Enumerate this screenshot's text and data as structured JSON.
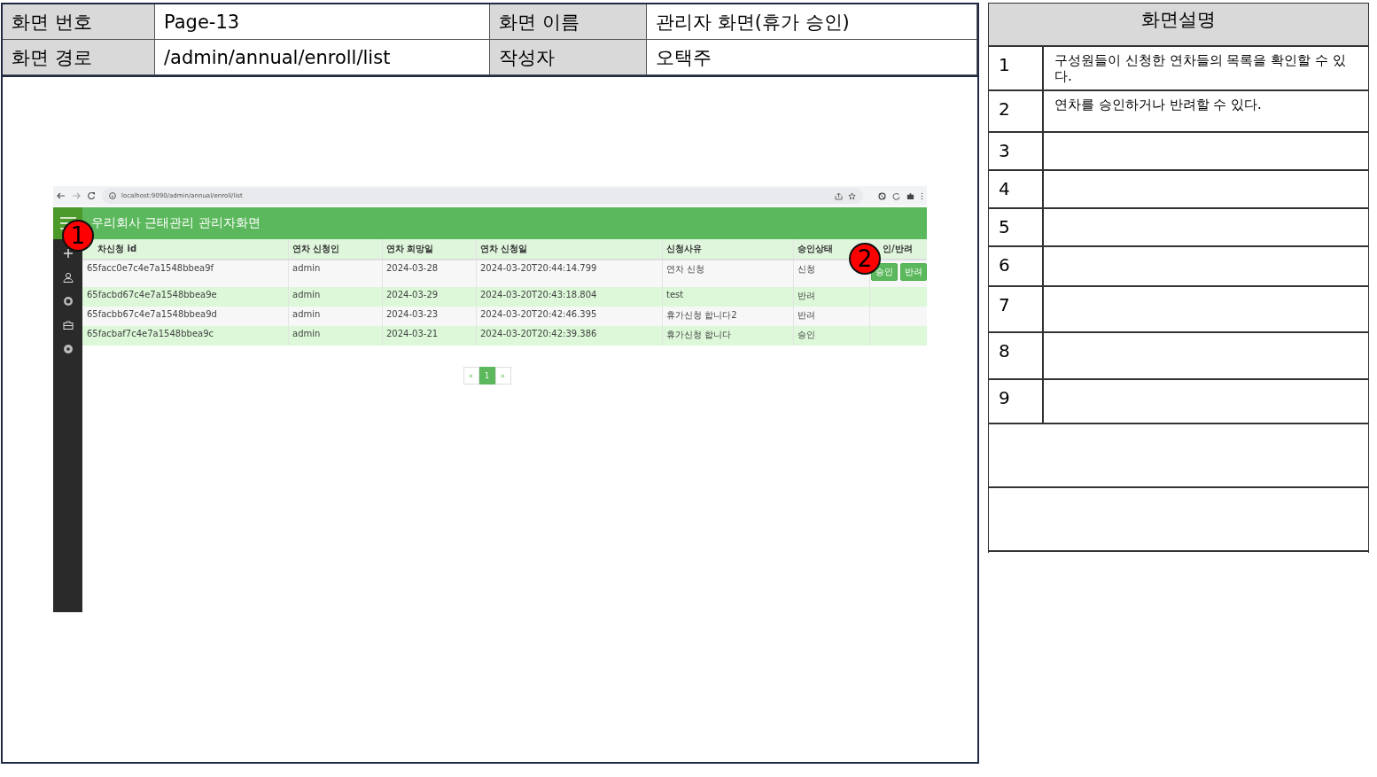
{
  "header": {
    "screen_no_label": "화면 번호",
    "screen_no": "Page-13",
    "screen_name_label": "화면 이름",
    "screen_name": "관리자 화면(휴가 승인)",
    "path_label": "화면 경로",
    "path": "/admin/annual/enroll/list",
    "author_label": "작성자",
    "author": "오택주"
  },
  "browser": {
    "url": "localhost:9090/admin/annual/enroll/list"
  },
  "app": {
    "title": "우리회사 근태관리 관리자화면",
    "columns": [
      "차신청 id",
      "연차 신청인",
      "연차 희망일",
      "연차 신청일",
      "신청사유",
      "승인상태",
      "인/반려"
    ],
    "rows": [
      {
        "cells": [
          "65facc0e7c4e7a1548bbea9f",
          "admin",
          "2024-03-28",
          "2024-03-20T20:44:14.799",
          "연차 신청",
          "신청"
        ],
        "actions": [
          "승인",
          "반려"
        ]
      },
      {
        "cells": [
          "65facbd67c4e7a1548bbea9e",
          "admin",
          "2024-03-29",
          "2024-03-20T20:43:18.804",
          "test",
          "반려"
        ]
      },
      {
        "cells": [
          "65facbb67c4e7a1548bbea9d",
          "admin",
          "2024-03-23",
          "2024-03-20T20:42:46.395",
          "휴가신청 합니다2",
          "반려"
        ]
      },
      {
        "cells": [
          "65facbaf7c4e7a1548bbea9c",
          "admin",
          "2024-03-21",
          "2024-03-20T20:42:39.386",
          "휴가신청 합니다",
          "승인"
        ]
      }
    ],
    "pagination": {
      "prev": "«",
      "pages": [
        {
          "label": "1",
          "selected": true
        }
      ],
      "next": "»"
    }
  },
  "markers": [
    "1",
    "2"
  ],
  "description": {
    "title": "화면설명",
    "items": [
      {
        "no": "1",
        "text": "구성원들이 신청한 연차들의 목록을 확인할 수 있다."
      },
      {
        "no": "2",
        "text": "연차를 승인하거나 반려할 수 있다."
      },
      {
        "no": "3"
      },
      {
        "no": "4"
      },
      {
        "no": "5"
      },
      {
        "no": "6"
      },
      {
        "no": "7"
      },
      {
        "no": "8"
      },
      {
        "no": "9"
      }
    ]
  }
}
